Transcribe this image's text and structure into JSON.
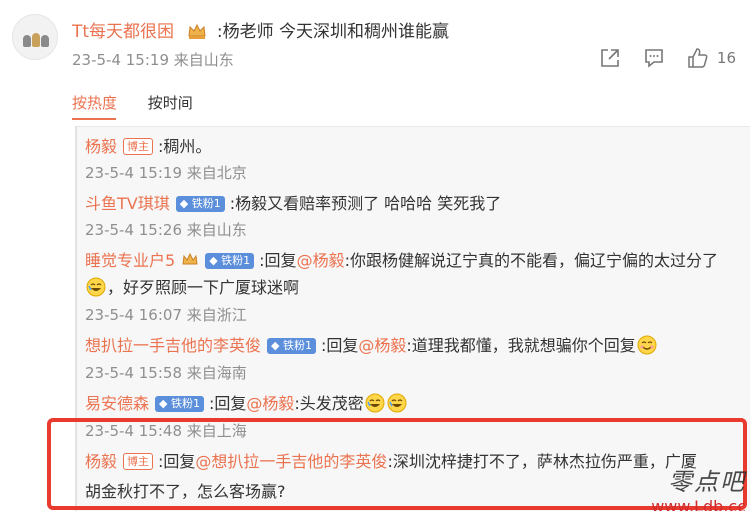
{
  "post": {
    "username": "Tt每天都很困",
    "text": ":杨老师 今天深圳和稠州谁能赢",
    "meta": "23-5-4 15:19 来自山东",
    "like_count": "16",
    "icons": [
      "share-icon",
      "comment-icon",
      "like-icon"
    ]
  },
  "sort": {
    "active": "按热度",
    "inactive": "按时间"
  },
  "replies": [
    {
      "user": "杨毅",
      "badge": "博主",
      "text": ":稠州。",
      "meta": "23-5-4 15:19 来自北京"
    },
    {
      "user": "斗鱼TV琪琪",
      "badge": "铁粉1",
      "text": ":杨毅又看赔率预测了 哈哈哈 笑死我了",
      "meta": "23-5-4 15:26 来自山东"
    },
    {
      "user": "睡觉专业户5",
      "badge": "铁粉1",
      "text_prefix": ":回复",
      "mention": "@杨毅",
      "text": ":你跟杨健解说辽宁真的不能看，偏辽宁偏的太过分了",
      "text2": "，好歹照顾一下广厦球迷啊",
      "meta": "23-5-4 16:07 来自浙江"
    },
    {
      "user": "想扒拉一手吉他的李英俊",
      "badge": "铁粉1",
      "text_prefix": ":回复",
      "mention": "@杨毅",
      "text": ":道理我都懂，我就想骗你个回复",
      "meta": "23-5-4 15:58 来自海南"
    },
    {
      "user": "易安德森",
      "badge": "铁粉1",
      "text_prefix": ":回复",
      "mention": "@杨毅",
      "text": ":头发茂密",
      "meta": "23-5-4 15:48 来自上海"
    },
    {
      "user": "杨毅",
      "badge": "博主",
      "text_prefix": ":回复",
      "mention": "@想扒拉一手吉他的李英俊",
      "text": ":深圳沈梓捷打不了，萨林杰拉伤严重，广厦",
      "text2": "胡金秋打不了，怎么客场赢?"
    }
  ],
  "watermark": {
    "title": "零点吧",
    "url": "www.Ldb.cc"
  },
  "colors": {
    "accent": "#eb7350",
    "fan_badge": "#5c8fdb",
    "highlight": "#e83a2e"
  }
}
